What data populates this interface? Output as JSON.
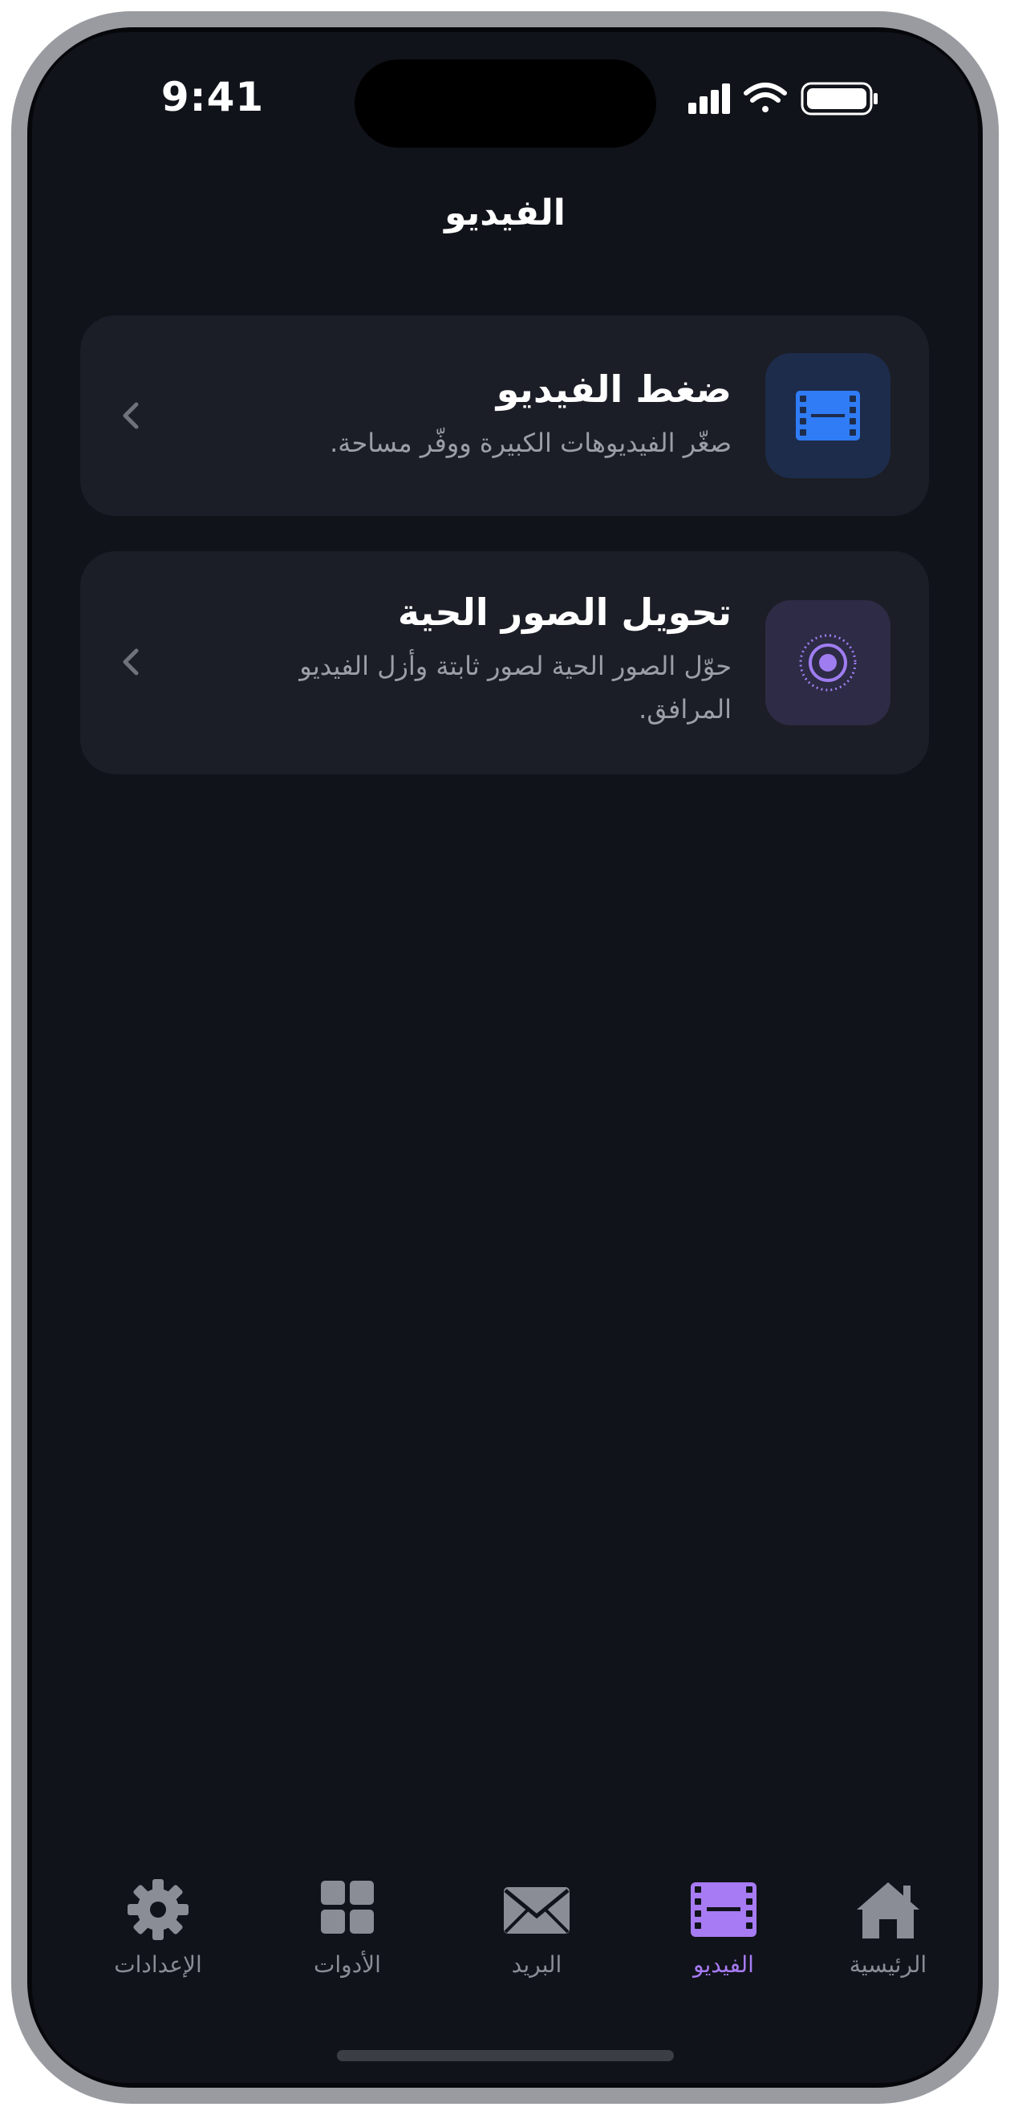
{
  "status_bar": {
    "time": "9:41"
  },
  "header": {
    "title": "الفيديو"
  },
  "cards": [
    {
      "title": "ضغط الفيديو",
      "description": "صغّر الفيديوهات الكبيرة ووفّر مساحة.",
      "icon": "film-icon"
    },
    {
      "title": "تحويل الصور الحية",
      "description": "حوّل الصور الحية لصور ثابتة وأزل الفيديو المرافق.",
      "icon": "live-photo-icon"
    }
  ],
  "tabbar": {
    "home": "الرئيسية",
    "video": "الفيديو",
    "mail": "البريد",
    "tools": "الأدوات",
    "settings": "الإعدادات",
    "active": "video"
  },
  "colors": {
    "background": "#10131a",
    "card": "#1c1e27",
    "accent_blue": "#2f7cf6",
    "accent_purple": "#a77bf3",
    "muted": "#8a8d95"
  }
}
